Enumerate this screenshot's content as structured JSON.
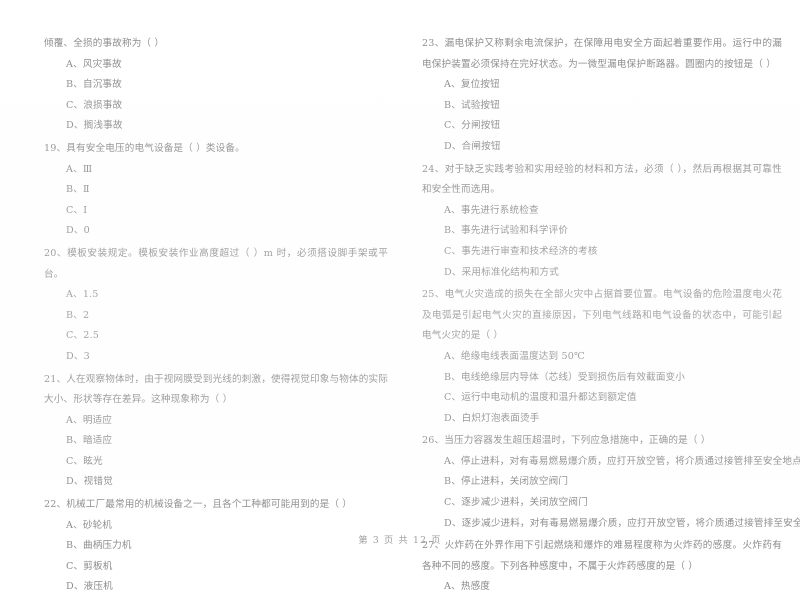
{
  "document": {
    "type": "exam-paper",
    "language": "zh-CN",
    "footer": "第 3 页  共 12 页"
  },
  "columns": {
    "left": {
      "questions": [
        {
          "number": "",
          "stem": "倾覆、全损的事故称为（      ）",
          "options": [
            "A、风灾事故",
            "B、自沉事故",
            "C、浪损事故",
            "D、搁浅事故"
          ]
        },
        {
          "number": "19",
          "stem": "19、具有安全电压的电气设备是（      ）类设备。",
          "options": [
            "A、Ⅲ",
            "B、Ⅱ",
            "C、Ⅰ",
            "D、0"
          ]
        },
        {
          "number": "20",
          "stem": "20、模板安装规定。模板安装作业高度超过（      ）m 时，必须搭设脚手架或平台。",
          "options": [
            "A、1.5",
            "B、2",
            "C、2.5",
            "D、3"
          ]
        },
        {
          "number": "21",
          "stem": "21、人在观察物体时，由于视网膜受到光线的刺激，使得视觉印象与物体的实际大小、形状等存在差异。这种现象称为（      ）",
          "options": [
            "A、明适应",
            "B、暗适应",
            "C、眩光",
            "D、视错觉"
          ]
        },
        {
          "number": "22",
          "stem": "22、机械工厂最常用的机械设备之一，且各个工种都可能用到的是（      ）",
          "options": [
            "A、砂轮机",
            "B、曲柄压力机",
            "C、剪板机",
            "D、液压机"
          ]
        }
      ]
    },
    "right": {
      "questions": [
        {
          "number": "23",
          "stem": "23、漏电保护又称剩余电流保护，在保障用电安全方面起着重要作用。运行中的漏电保护装置必须保持在完好状态。为一微型漏电保护断路器。圆圈内的按钮是（      ）",
          "options": [
            "A、复位按钮",
            "B、试验按钮",
            "C、分闸按钮",
            "D、合闸按钮"
          ]
        },
        {
          "number": "24",
          "stem": "24、对于缺乏实践考验和实用经验的材料和方法，必须（      ），然后再根据其可靠性和安全性而选用。",
          "options": [
            "A、事先进行系统检查",
            "B、事先进行试验和科学评价",
            "C、事先进行审查和技术经济的考核",
            "D、采用标准化结构和方式"
          ]
        },
        {
          "number": "25",
          "stem": "25、电气火灾造成的损失在全部火灾中占据首要位置。电气设备的危险温度电火花及电弧是引起电气火灾的直接原因，下列电气线路和电气设备的状态中，可能引起电气火灾的是（      ）",
          "options": [
            "A、绝缘电线表面温度达到 50℃",
            "B、电线绝缘层内导体（芯线）受到损伤后有效截面变小",
            "C、运行中电动机的温度和温升都达到额定值",
            "D、白炽灯泡表面烫手"
          ]
        },
        {
          "number": "26",
          "stem": "26、当压力容器发生超压超温时，下列应急措施中，正确的是（      ）",
          "options": [
            "A、停止进料，对有毒易燃易爆介质，应打开放空管，将介质通过接管排至安全地点",
            "B、停止进料，关闭放空阀门",
            "C、逐步减少进料，关闭放空阀门",
            "D、逐步减少进料，对有毒易燃易爆介质，应打开放空管，将介质通过接管排至安全地点"
          ]
        },
        {
          "number": "27",
          "stem": "27、火炸药在外界作用下引起燃烧和爆炸的难易程度称为火炸药的感度。火炸药有各种不同的感度。下列各种感度中，不属于火炸药感度的是（      ）",
          "options": [
            "A、热感度"
          ]
        }
      ]
    }
  }
}
